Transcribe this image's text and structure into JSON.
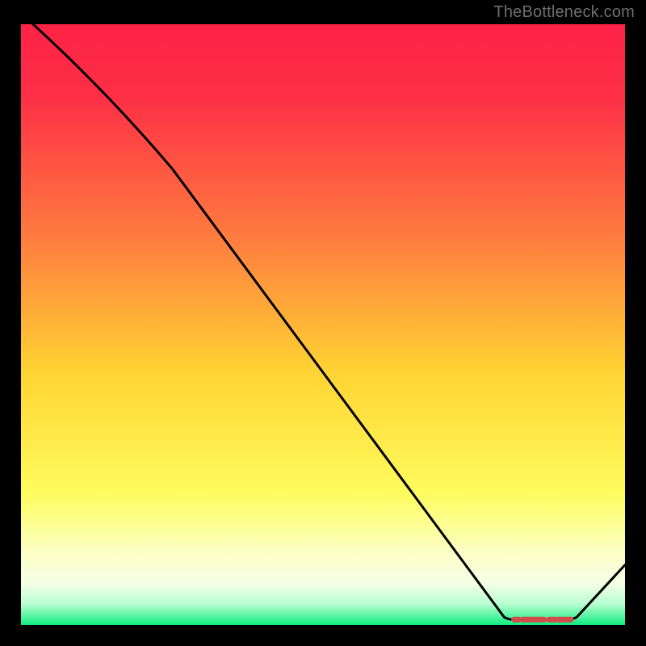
{
  "attribution": "TheBottleneck.com",
  "chart_data": {
    "type": "line",
    "title": "",
    "xlabel": "",
    "ylabel": "",
    "xlim": [
      0,
      100
    ],
    "ylim": [
      0,
      100
    ],
    "gradient": {
      "top": "#fd2246",
      "upper_mid": "#ff7a3f",
      "mid": "#ffd433",
      "lower_mid": "#fffc5d",
      "band_light": "#fbffc6",
      "bottom": "#10ec7f"
    },
    "series": [
      {
        "name": "main-curve",
        "points": [
          {
            "x": 2.0,
            "y": 100.0
          },
          {
            "x": 25.0,
            "y": 76.0
          },
          {
            "x": 80.0,
            "y": 1.3
          },
          {
            "x": 81.5,
            "y": 0.9
          },
          {
            "x": 90.5,
            "y": 0.9
          },
          {
            "x": 92.0,
            "y": 1.3
          },
          {
            "x": 100.0,
            "y": 10.0
          }
        ]
      }
    ],
    "markers": {
      "name": "flat-segment-dashes",
      "y": 0.9,
      "x_start": 81.5,
      "x_end": 90.5,
      "color": "#d24a4a"
    }
  }
}
